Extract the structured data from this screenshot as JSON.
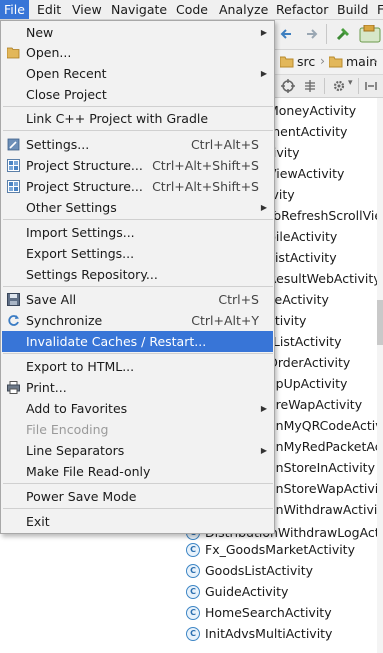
{
  "menubar": {
    "items": [
      "File",
      "Edit",
      "View",
      "Navigate",
      "Code",
      "Analyze",
      "Refactor",
      "Build",
      "F"
    ]
  },
  "breadcrumbs": [
    "src",
    "main"
  ],
  "file_menu": {
    "items": [
      {
        "label": "New",
        "shortcut": "",
        "submenu": true
      },
      {
        "label": "Open...",
        "shortcut": "",
        "submenu": false
      },
      {
        "label": "Open Recent",
        "shortcut": "",
        "submenu": true
      },
      {
        "label": "Close Project",
        "shortcut": "",
        "submenu": false
      },
      {
        "label": "Link C++ Project with Gradle",
        "shortcut": "",
        "submenu": false
      },
      {
        "label": "Settings...",
        "shortcut": "Ctrl+Alt+S",
        "submenu": false
      },
      {
        "label": "Project Structure...",
        "shortcut": "Ctrl+Alt+Shift+S",
        "submenu": false
      },
      {
        "label": "Project Structure...",
        "shortcut": "Ctrl+Alt+Shift+S",
        "submenu": false
      },
      {
        "label": "Other Settings",
        "shortcut": "",
        "submenu": true
      },
      {
        "label": "Import Settings...",
        "shortcut": "",
        "submenu": false
      },
      {
        "label": "Export Settings...",
        "shortcut": "",
        "submenu": false
      },
      {
        "label": "Settings Repository...",
        "shortcut": "",
        "submenu": false
      },
      {
        "label": "Save All",
        "shortcut": "Ctrl+S",
        "submenu": false
      },
      {
        "label": "Synchronize",
        "shortcut": "Ctrl+Alt+Y",
        "submenu": false
      },
      {
        "label": "Invalidate Caches / Restart...",
        "shortcut": "",
        "submenu": false
      },
      {
        "label": "Export to HTML...",
        "shortcut": "",
        "submenu": false
      },
      {
        "label": "Print...",
        "shortcut": "",
        "submenu": false
      },
      {
        "label": "Add to Favorites",
        "shortcut": "",
        "submenu": true
      },
      {
        "label": "File Encoding",
        "shortcut": "",
        "submenu": false
      },
      {
        "label": "Line Separators",
        "shortcut": "",
        "submenu": true
      },
      {
        "label": "Make File Read-only",
        "shortcut": "",
        "submenu": false
      },
      {
        "label": "Power Save Mode",
        "shortcut": "",
        "submenu": false
      },
      {
        "label": "Exit",
        "shortcut": "",
        "submenu": false
      }
    ]
  },
  "tree": {
    "partial_items": [
      "MoneyActivity",
      "mentActivity",
      "tivity",
      "ViewActivity",
      "ivity",
      "ToRefreshScrollView",
      "bileActivity",
      "ListActivity",
      "ResultWebActivity",
      "seActivity",
      "ctivity",
      "tListActivity",
      "OrderActivity",
      "opUpActivity",
      "oreWapActivity",
      "onMyQRCodeActiv",
      "onMyRedPacketAc",
      "onStoreInActivity",
      "onStoreWapActivity",
      "onWithdrawActivity",
      "DistributionWithdrawLogActi"
    ],
    "items": [
      "Fx_GoodsMarketActivity",
      "GoodsListActivity",
      "GuideActivity",
      "HomeSearchActivity",
      "InitAdvsMultiActivity"
    ]
  }
}
